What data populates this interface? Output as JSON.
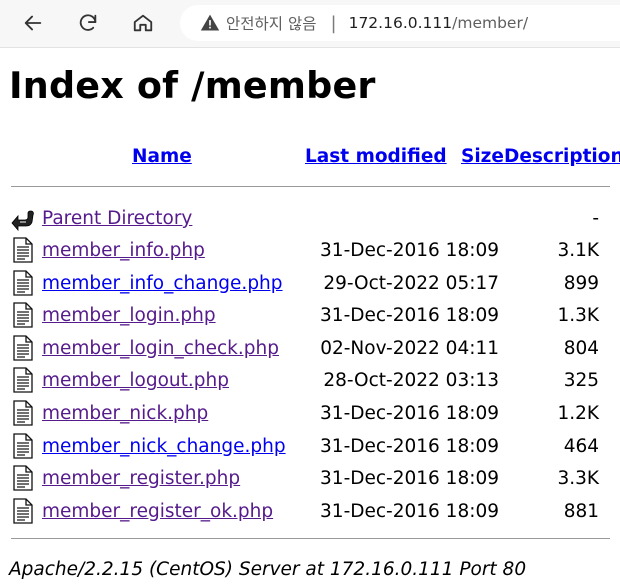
{
  "browser": {
    "security_label": "안전하지 않음",
    "url_host": "172.16.0.111",
    "url_path": "/member/"
  },
  "page": {
    "title": "Index of /member",
    "columns": {
      "name": "Name",
      "last_modified": "Last modified",
      "size": "Size",
      "description": "Description"
    },
    "parent": {
      "name": "Parent Directory",
      "size": "-"
    },
    "files": [
      {
        "name": "member_info.php",
        "modified": "31-Dec-2016 18:09",
        "size": "3.1K",
        "visited": true
      },
      {
        "name": "member_info_change.php",
        "modified": "29-Oct-2022 05:17",
        "size": "899",
        "visited": false
      },
      {
        "name": "member_login.php",
        "modified": "31-Dec-2016 18:09",
        "size": "1.3K",
        "visited": true
      },
      {
        "name": "member_login_check.php",
        "modified": "02-Nov-2022 04:11",
        "size": "804",
        "visited": true
      },
      {
        "name": "member_logout.php",
        "modified": "28-Oct-2022 03:13",
        "size": "325",
        "visited": true
      },
      {
        "name": "member_nick.php",
        "modified": "31-Dec-2016 18:09",
        "size": "1.2K",
        "visited": true
      },
      {
        "name": "member_nick_change.php",
        "modified": "31-Dec-2016 18:09",
        "size": "464",
        "visited": false
      },
      {
        "name": "member_register.php",
        "modified": "31-Dec-2016 18:09",
        "size": "3.3K",
        "visited": true
      },
      {
        "name": "member_register_ok.php",
        "modified": "31-Dec-2016 18:09",
        "size": "881",
        "visited": true
      }
    ],
    "footer": "Apache/2.2.15 (CentOS) Server at 172.16.0.111 Port 80"
  }
}
